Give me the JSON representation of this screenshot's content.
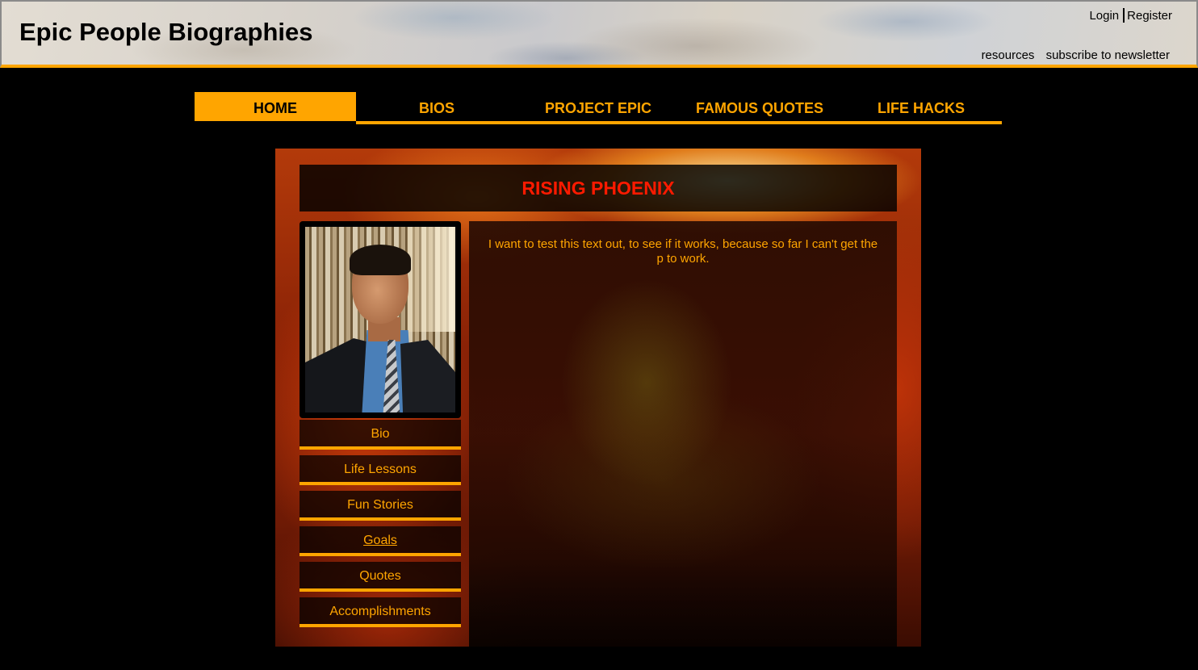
{
  "header": {
    "site_title": "Epic People Biographies",
    "login_label": "Login",
    "register_label": "Register",
    "resources_label": "resources",
    "newsletter_label": "subscribe to newsletter"
  },
  "nav": {
    "items": [
      {
        "label": "HOME",
        "active": true
      },
      {
        "label": "BIOS"
      },
      {
        "label": "PROJECT EPIC"
      },
      {
        "label": "FAMOUS QUOTES"
      },
      {
        "label": "LIFE HACKS"
      }
    ]
  },
  "profile": {
    "title": "RISING PHOENIX",
    "menu": [
      {
        "label": "Bio"
      },
      {
        "label": "Life Lessons"
      },
      {
        "label": "Fun Stories"
      },
      {
        "label": "Goals",
        "underlined": true
      },
      {
        "label": "Quotes"
      },
      {
        "label": "Accomplishments"
      }
    ],
    "content_text": "I want to test this text out, to see if it works, because so far I can't get the p to work."
  },
  "colors": {
    "accent": "#ffa500",
    "title_red": "#ff1a00",
    "background": "#000000"
  }
}
